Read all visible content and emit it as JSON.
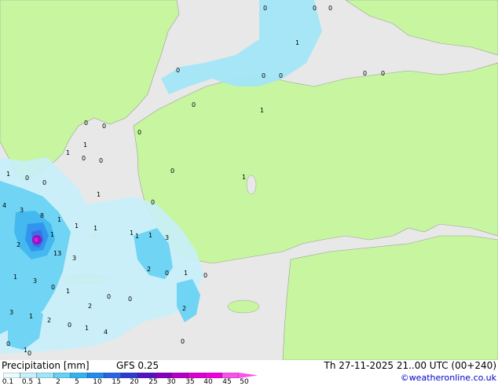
{
  "map": {
    "point_values": [
      "0",
      "0",
      "0",
      "1",
      "0",
      "0",
      "0",
      "0",
      "0",
      "0",
      "1",
      "0",
      "0",
      "1",
      "0",
      "1",
      "0",
      "0",
      "0",
      "1",
      "1",
      "0",
      "0",
      "1",
      "0",
      "4",
      "8",
      "1",
      "3",
      "1",
      "2",
      "1",
      "13",
      "3",
      "1",
      "1",
      "1",
      "1",
      "3",
      "2",
      "0",
      "1",
      "0",
      "1",
      "3",
      "0",
      "1",
      "0",
      "0",
      "2",
      "2",
      "3",
      "1",
      "2",
      "0",
      "4",
      "0",
      "1",
      "0",
      "0",
      "1"
    ]
  },
  "footer": {
    "title": "Precipitation [mm]",
    "model": "GFS 0.25",
    "timestamp": "Th 27-11-2025 21..00 UTC (00+240)",
    "credit": "©weatheronline.co.uk"
  },
  "legend": {
    "ticks": [
      "0.1",
      "0.5",
      "1",
      "2",
      "5",
      "10",
      "15",
      "20",
      "25",
      "30",
      "35",
      "40",
      "45",
      "50"
    ],
    "colors": [
      "#eafcfe",
      "#c8f0fa",
      "#a0e6f8",
      "#64d2f6",
      "#32b4f0",
      "#1e8cf0",
      "#2864e6",
      "#2d3cd2",
      "#5014c8",
      "#8200be",
      "#b400c8",
      "#dc00d2",
      "#f000dc",
      "#fa50ec"
    ],
    "land_color": "#c8f5a0",
    "sea_color": "#e8e8e8",
    "border_color": "#9aa09a"
  }
}
